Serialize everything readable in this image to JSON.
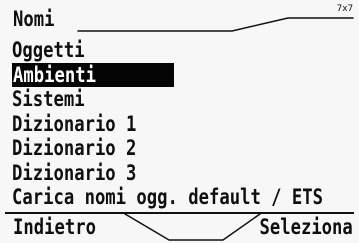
{
  "screen": {
    "title": "Nomi",
    "counter": "7x7"
  },
  "menu": {
    "items": [
      {
        "label": "Oggetti"
      },
      {
        "label": "Ambienti"
      },
      {
        "label": "Sistemi"
      },
      {
        "label": "Dizionario 1"
      },
      {
        "label": "Dizionario 2"
      },
      {
        "label": "Dizionario 3"
      },
      {
        "label": "Carica nomi ogg. default / ETS"
      }
    ],
    "selected_index": 1
  },
  "softkeys": {
    "left": "Indietro",
    "right": "Seleziona"
  }
}
